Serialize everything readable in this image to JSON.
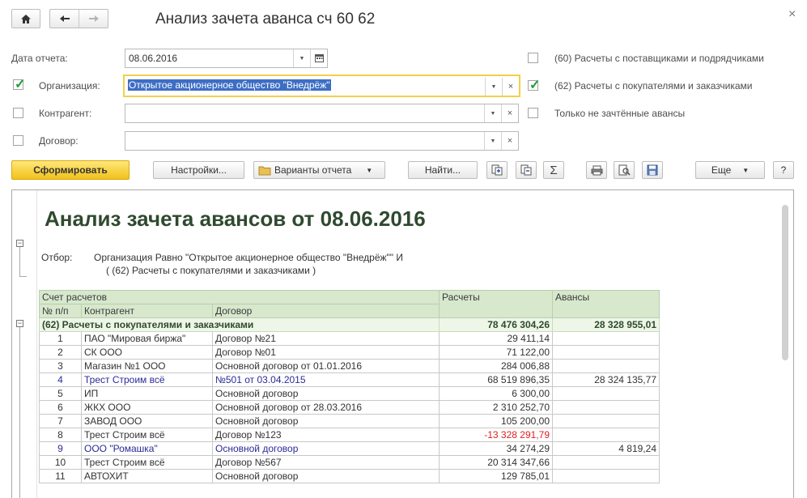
{
  "window": {
    "title": "Анализ зачета аванса сч 60 62",
    "close": "×"
  },
  "form": {
    "report_date": {
      "label": "Дата отчета:",
      "value": "08.06.2016"
    },
    "organization": {
      "label": "Организация:",
      "value": "Открытое акционерное общество \"Внедрёж\"",
      "checked": true
    },
    "counterparty": {
      "label": "Контрагент:",
      "value": "",
      "checked": false
    },
    "contract": {
      "label": "Договор:",
      "value": "",
      "checked": false
    },
    "opt60": {
      "label": "(60) Расчеты с поставщиками и подрядчиками",
      "checked": false
    },
    "opt62": {
      "label": "(62) Расчеты с покупателями и заказчиками",
      "checked": true
    },
    "only_unoffset": {
      "label": "Только не зачтённые авансы",
      "checked": false
    }
  },
  "toolbar": {
    "generate": "Сформировать",
    "settings": "Настройки...",
    "variants": "Варианты отчета",
    "find": "Найти...",
    "sum": "Σ",
    "more": "Еще",
    "help": "?"
  },
  "report": {
    "title": "Анализ зачета авансов от 08.06.2016",
    "filter_label": "Отбор:",
    "filter_line1": "Организация Равно \"Открытое акционерное общество \"Внедрёж\"\" И",
    "filter_line2": "( (62) Расчеты с покупателями и заказчиками )",
    "headers": {
      "account": "Счет расчетов",
      "num": "№ п/п",
      "counterparty": "Контрагент",
      "contract": "Договор",
      "settlements": "Расчеты",
      "advances": "Авансы"
    },
    "group": {
      "name": "(62) Расчеты с покупателями и заказчиками",
      "settlements": "78 476 304,26",
      "advances": "28 328 955,01"
    },
    "rows": [
      {
        "n": "1",
        "counterparty": "ПАО \"Мировая биржа\"",
        "contract": "Договор №21",
        "settlements": "29 411,14",
        "advances": "",
        "style": ""
      },
      {
        "n": "2",
        "counterparty": "СК ООО",
        "contract": "Договор №01",
        "settlements": "71 122,00",
        "advances": "",
        "style": ""
      },
      {
        "n": "3",
        "counterparty": "Магазин №1 ООО",
        "contract": "Основной договор от 01.01.2016",
        "settlements": "284 006,88",
        "advances": "",
        "style": ""
      },
      {
        "n": "4",
        "counterparty": "Трест Строим всё",
        "contract": "№501 от 03.04.2015",
        "settlements": "68 519 896,35",
        "advances": "28 324 135,77",
        "style": "blue"
      },
      {
        "n": "5",
        "counterparty": "ИП",
        "contract": "Основной договор",
        "settlements": "6 300,00",
        "advances": "",
        "style": ""
      },
      {
        "n": "6",
        "counterparty": "ЖКХ ООО",
        "contract": "Основной договор от 28.03.2016",
        "settlements": "2 310 252,70",
        "advances": "",
        "style": ""
      },
      {
        "n": "7",
        "counterparty": "ЗАВОД ООО",
        "contract": "Основной договор",
        "settlements": "105 200,00",
        "advances": "",
        "style": ""
      },
      {
        "n": "8",
        "counterparty": "Трест Строим всё",
        "contract": "Договор №123",
        "settlements": "-13 328 291,79",
        "advances": "",
        "style": "red"
      },
      {
        "n": "9",
        "counterparty": "ООО \"Ромашка\"",
        "contract": "Основной договор",
        "settlements": "34 274,29",
        "advances": "4 819,24",
        "style": "blue"
      },
      {
        "n": "10",
        "counterparty": "Трест Строим всё",
        "contract": "Договор №567",
        "settlements": "20 314 347,66",
        "advances": "",
        "style": ""
      },
      {
        "n": "11",
        "counterparty": "АВТОХИТ",
        "contract": "Основной договор",
        "settlements": "129 785,01",
        "advances": "",
        "style": ""
      }
    ]
  }
}
